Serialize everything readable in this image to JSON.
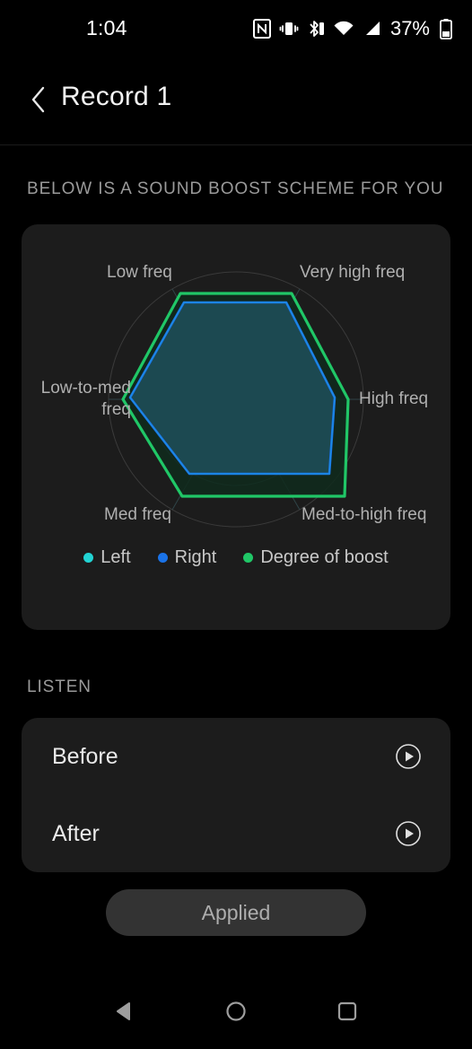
{
  "status_bar": {
    "time": "1:04",
    "battery_percent": "37%",
    "icons": [
      "nfc-icon",
      "vibrate-icon",
      "bluetooth-icon",
      "wifi-icon",
      "cellular-signal-icon",
      "battery-icon"
    ]
  },
  "app_bar": {
    "back_icon": "chevron-left-icon",
    "title": "Record 1"
  },
  "sections": {
    "scheme_header": "BELOW IS A SOUND BOOST SCHEME FOR YOU",
    "listen_header": "LISTEN"
  },
  "legend": [
    {
      "label": "Left",
      "color": "#22D3D3"
    },
    {
      "label": "Right",
      "color": "#1A73E8"
    },
    {
      "label": "Degree of boost",
      "color": "#20C767"
    }
  ],
  "listen": {
    "rows": [
      {
        "label": "Before",
        "icon": "play-circle-icon"
      },
      {
        "label": "After",
        "icon": "play-circle-icon"
      }
    ]
  },
  "applied_button": {
    "label": "Applied"
  },
  "nav_bar": {
    "back_icon": "triangle-back-icon",
    "home_icon": "circle-home-icon",
    "recents_icon": "square-recents-icon"
  },
  "chart_data": {
    "type": "radar",
    "title": "",
    "categories": [
      "Very high freq",
      "High freq",
      "Med-to-high freq",
      "Med freq",
      "Low-to-med freq",
      "Low freq"
    ],
    "rmax": 1.0,
    "grid": true,
    "grid_rings": [
      0.08,
      0.2,
      0.42,
      0.68,
      1.0
    ],
    "legend_position": "bottom",
    "series": [
      {
        "name": "Left",
        "color": "#22D3D3",
        "values": [
          0.9,
          0.88,
          0.86,
          0.7,
          0.95,
          0.93
        ]
      },
      {
        "name": "Right",
        "color": "#1A73E8",
        "values": [
          0.9,
          0.88,
          0.86,
          0.7,
          0.95,
          0.93
        ]
      },
      {
        "name": "Degree of boost",
        "color": "#20C767",
        "values": [
          0.97,
          1.0,
          1.0,
          0.92,
          1.0,
          0.97
        ]
      }
    ],
    "axis_labels": {
      "very_high_freq": "Very high freq",
      "high_freq": "High freq",
      "med_to_high_freq": "Med-to-high freq",
      "med_freq": "Med freq",
      "low_to_med_freq": "Low-to-med freq",
      "low_freq": "Low freq"
    }
  }
}
